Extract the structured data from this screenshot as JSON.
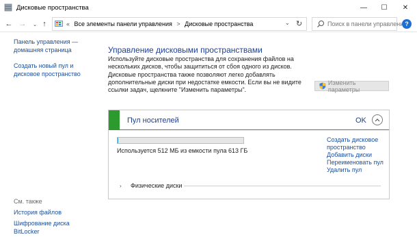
{
  "window": {
    "title": "Дисковые пространства",
    "controls": {
      "minimize": "—",
      "maximize": "☐",
      "close": "✕"
    }
  },
  "nav": {
    "back": "←",
    "forward": "→",
    "recent": "⌄",
    "up": "↑",
    "breadcrumbs": [
      "«",
      "Все элементы панели управления",
      ">",
      "Дисковые пространства"
    ],
    "address_dropdown": "⌄",
    "refresh": "↻",
    "search_placeholder": "Поиск в панели управления",
    "help": "?"
  },
  "sidebar": {
    "home": "Панель управления — домашняя страница",
    "create_pool": "Создать новый пул и дисковое пространство",
    "see_also": "См. также",
    "file_history": "История файлов",
    "bitlocker": "Шифрование диска BitLocker"
  },
  "main": {
    "title": "Управление дисковыми пространствами",
    "intro": "Используйте дисковые пространства для сохранения файлов на нескольких дисков, чтобы защититься от сбоя одного из дисков. Дисковые пространства также позволяют легко добавлять дополнительные диски при недостатке емкости. Если вы не видите ссылки задач, щелкните \"Изменить параметры\".",
    "change_settings": "Изменить параметры"
  },
  "pool": {
    "name": "Пул носителей",
    "status": "OK",
    "collapse_glyph": "⌃",
    "usage_fraction": 0.0008,
    "usage_text": "Используется 512 МБ из емкости пула 613 ГБ",
    "tasks": [
      "Создать дисковое пространство",
      "Добавить диски",
      "Переименовать пул",
      "Удалить пул"
    ],
    "physical_disks_label": "Физические диски",
    "physical_disks_chevron": "›"
  },
  "colors": {
    "link": "#1a4f9c",
    "heading": "#1e3f91",
    "status_green": "#2d9a2d"
  }
}
